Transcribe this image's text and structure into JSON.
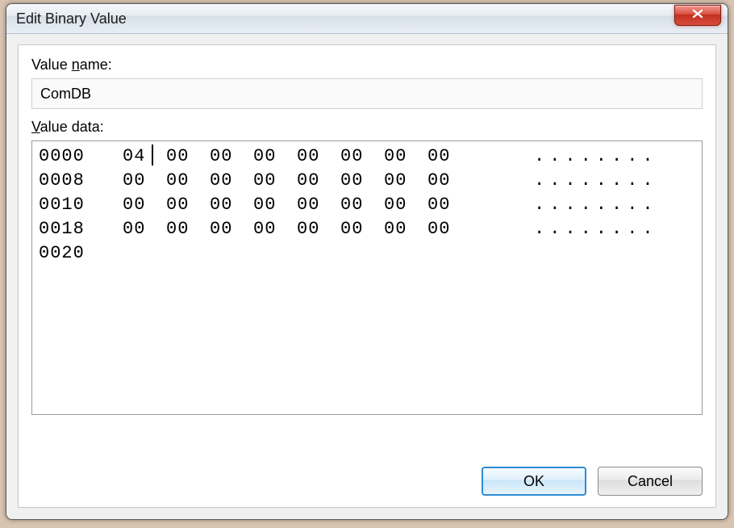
{
  "window": {
    "title": "Edit Binary Value"
  },
  "labels": {
    "value_name_pre": "Value ",
    "value_name_accel": "n",
    "value_name_post": "ame:",
    "value_data_accel": "V",
    "value_data_post": "alue data:"
  },
  "value_name": "ComDB",
  "hex": {
    "rows": [
      {
        "offset": "0000",
        "bytes": [
          "04",
          "00",
          "00",
          "00",
          "00",
          "00",
          "00",
          "00"
        ],
        "ascii": "........"
      },
      {
        "offset": "0008",
        "bytes": [
          "00",
          "00",
          "00",
          "00",
          "00",
          "00",
          "00",
          "00"
        ],
        "ascii": "........"
      },
      {
        "offset": "0010",
        "bytes": [
          "00",
          "00",
          "00",
          "00",
          "00",
          "00",
          "00",
          "00"
        ],
        "ascii": "........"
      },
      {
        "offset": "0018",
        "bytes": [
          "00",
          "00",
          "00",
          "00",
          "00",
          "00",
          "00",
          "00"
        ],
        "ascii": "........"
      },
      {
        "offset": "0020",
        "bytes": [],
        "ascii": ""
      }
    ],
    "caret_row": 0,
    "caret_after_byte": 1
  },
  "buttons": {
    "ok": "OK",
    "cancel": "Cancel"
  }
}
